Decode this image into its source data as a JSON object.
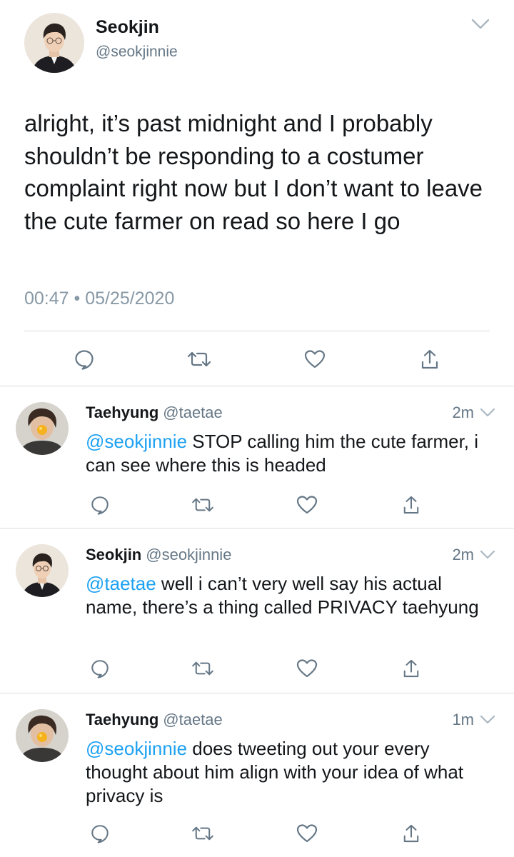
{
  "main_tweet": {
    "author_name": "Seokjin",
    "author_handle": "@seokjinnie",
    "text": "alright, it’s past midnight and I probably shouldn’t be responding to a costumer complaint right now but I don’t want to leave the cute farmer on read so here I go",
    "time": "00:47",
    "separator": "•",
    "date": "05/25/2020",
    "actions": [
      "reply-icon",
      "retweet-icon",
      "like-icon",
      "share-icon"
    ]
  },
  "replies": [
    {
      "author_name": "Taehyung",
      "author_handle": "@taetae",
      "time_ago": "2m",
      "mention": "@seokjinnie",
      "text": " STOP calling him the cute farmer, i can see where this is headed"
    },
    {
      "author_name": "Seokjin",
      "author_handle": "@seokjinnie",
      "time_ago": "2m",
      "mention": "@taetae",
      "text": " well i can’t very well say his actual name, there’s a thing called PRIVACY taehyung"
    },
    {
      "author_name": "Taehyung",
      "author_handle": "@taetae",
      "time_ago": "1m",
      "mention": "@seokjinnie",
      "text": " does tweeting out your every thought about him align with your idea of what privacy is"
    }
  ],
  "colors": {
    "text": "#14171a",
    "secondary": "#657786",
    "meta": "#8899a6",
    "link": "#1da1f2",
    "divider": "#d8dce0",
    "icon": "#657786"
  }
}
